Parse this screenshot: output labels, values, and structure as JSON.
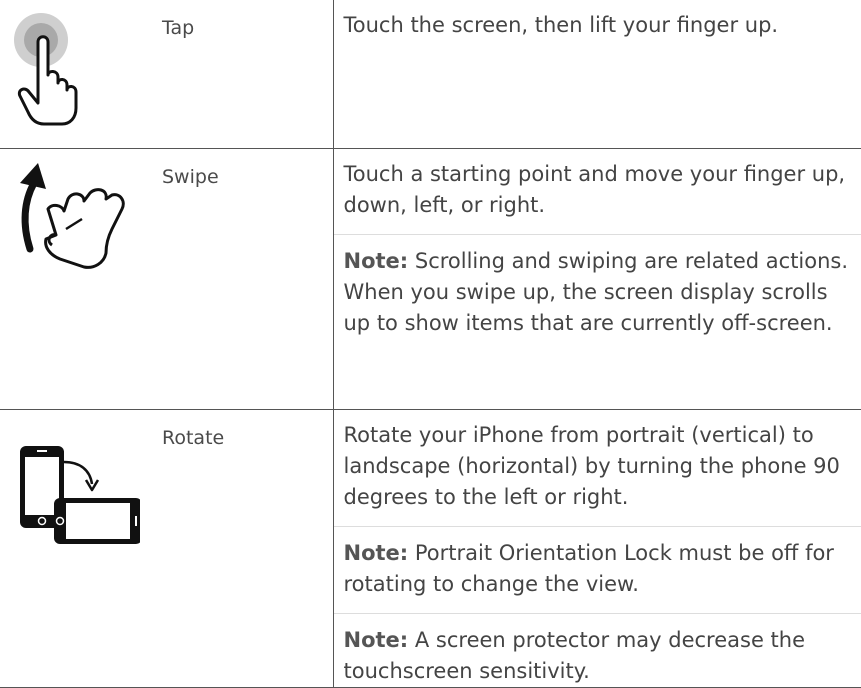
{
  "gestures": [
    {
      "name": "Tap",
      "icon": "tap-gesture-icon",
      "description": "Touch the screen, then lift your finger up.",
      "notes": []
    },
    {
      "name": "Swipe",
      "icon": "swipe-gesture-icon",
      "description": "Touch a starting point and move your finger up, down, left, or right.",
      "notes": [
        {
          "label": "Note:",
          "text": " Scrolling and swiping are related actions. When you swipe up, the screen display scrolls up to show items that are currently off-screen."
        }
      ]
    },
    {
      "name": "Rotate",
      "icon": "rotate-phone-icon",
      "description": "Rotate your iPhone from portrait (vertical) to landscape (horizontal) by turning the phone 90 degrees to the left or right.",
      "notes": [
        {
          "label": "Note:",
          "text": " Portrait Orientation Lock must be off for rotating to change the view."
        },
        {
          "label": "Note:",
          "text": " A screen protector may decrease the touchscreen sensitivity."
        }
      ]
    }
  ],
  "colors": {
    "text": "#444444",
    "border": "#555555",
    "tap_halo": "#c8c8c8"
  }
}
